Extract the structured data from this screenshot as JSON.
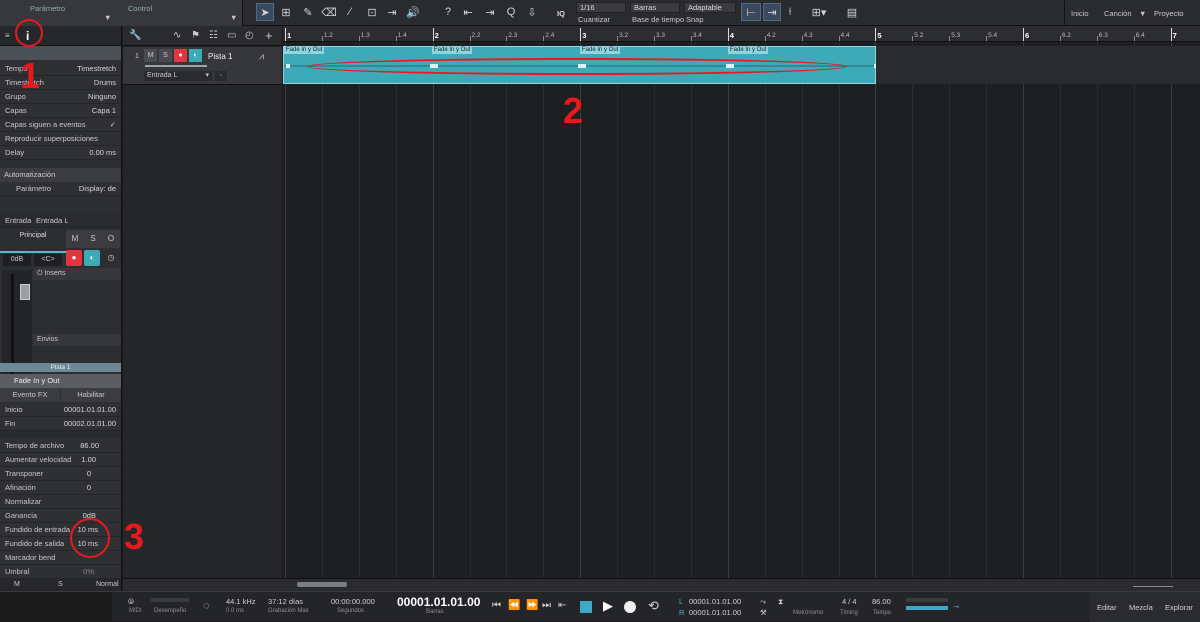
{
  "topbar": {
    "menu_parametro": "Parámetro",
    "menu_control": "Control",
    "quantize_value": "1/16",
    "quantize_label": "Cuantizar",
    "timebase_value": "Barras",
    "timebase_label": "Base de tiempo",
    "snap_value": "Adaptable",
    "snap_label": "Snap",
    "iq_label": "IQ",
    "nav_inicio": "Inicio",
    "nav_cancion": "Canción",
    "nav_proyecto": "Proyecto"
  },
  "inspector": {
    "info_icon_label": "i",
    "rows": [
      {
        "label": "Tempo",
        "value": "Timestretch"
      },
      {
        "label": "Timestretch",
        "value": "Drums"
      },
      {
        "label": "Grupo",
        "value": "Ninguno"
      },
      {
        "label": "Capas",
        "value": "Capa 1"
      },
      {
        "label": "Capas siguen a eventos",
        "value": "✓"
      },
      {
        "label": "Reproducir superposiciones",
        "value": ""
      },
      {
        "label": "Delay",
        "value": "0.00 ms"
      }
    ],
    "automation_label": "Automatización",
    "param_label": "Parámetro",
    "param_display": "Display: de",
    "input_label": "Entrada",
    "input_value": "Entrada L",
    "principal_label": "Principal",
    "db_label": "0dB",
    "pan_label": "<C>",
    "inserts_label": "Inserts",
    "envios_label": "Envios",
    "m_label": "M",
    "s_label": "S",
    "o_label": "O",
    "track_name_bar": "Pista 1",
    "event_name": "Fade In y Out",
    "event_fx_label": "Evento FX",
    "habilitar_label": "Habilitar",
    "event_rows": [
      {
        "label": "Inicio",
        "value": "00001.01.01.00"
      },
      {
        "label": "Fin",
        "value": "00002.01.01.00"
      },
      {
        "label": "",
        "value": ""
      },
      {
        "label": "Tempo de archivo",
        "value": "86.00"
      },
      {
        "label": "Aumentar velocidad",
        "value": "1.00"
      },
      {
        "label": "Transponer",
        "value": "0"
      },
      {
        "label": "Afinación",
        "value": "0"
      },
      {
        "label": "Normalizar",
        "value": ""
      },
      {
        "label": "Ganancia",
        "value": "0dB"
      },
      {
        "label": "Fundido de entrada",
        "value": "10 ms"
      },
      {
        "label": "Fundido de salida",
        "value": "10 ms"
      },
      {
        "label": "Marcador bend",
        "value": ""
      },
      {
        "label": "Umbral",
        "value": "0%"
      }
    ],
    "bottom_m": "M",
    "bottom_s": "S",
    "bottom_mode": "Normal"
  },
  "tracklist": {
    "track_number": "1",
    "m_label": "M",
    "s_label": "S",
    "track_name": "Pista 1",
    "input_value": "Entrada L"
  },
  "ruler": {
    "ticks": [
      "1",
      "1.2",
      "1.3",
      "1.4",
      "2",
      "2.2",
      "2.3",
      "2.4",
      "3",
      "3.2",
      "3.3",
      "3.4",
      "4",
      "4.2",
      "4.3",
      "4.4",
      "5",
      "5.2",
      "5.3",
      "5.4",
      "6",
      "6.2",
      "6.3",
      "6.4",
      "7"
    ]
  },
  "event": {
    "fade_labels": [
      "Fade In y Out",
      "Fade In y Out",
      "Fade In y Out",
      "Fade In y Out"
    ]
  },
  "annotations": {
    "mark1": "1",
    "mark2": "2",
    "mark3": "3"
  },
  "transport": {
    "midi_label": "MIDI",
    "desempeno_label": "Desempeño",
    "sample_rate": "44.1 kHz",
    "latency": "0.0 ms",
    "record_days": "37:12 días",
    "record_max_label": "Grabación Max",
    "seconds_value": "00:00:00.000",
    "seconds_label": "Segundos",
    "bars_value": "00001.01.01.00",
    "bars_label": "Barras",
    "loop_l": "00001.01.01.00",
    "loop_r": "00001.01.01.00",
    "l_label": "L",
    "r_label": "R",
    "metronome_label": "Metrónomo",
    "timing_value": "4 / 4",
    "timing_label": "Timing",
    "tempo_value": "86.00",
    "tempo_label": "Tempo",
    "editar": "Editar",
    "mezcla": "Mezcla",
    "explorar": "Explorar"
  },
  "colors": {
    "accent_teal": "#3ea9b7",
    "annotation_red": "#e8191c",
    "record_red": "#e5343e"
  }
}
